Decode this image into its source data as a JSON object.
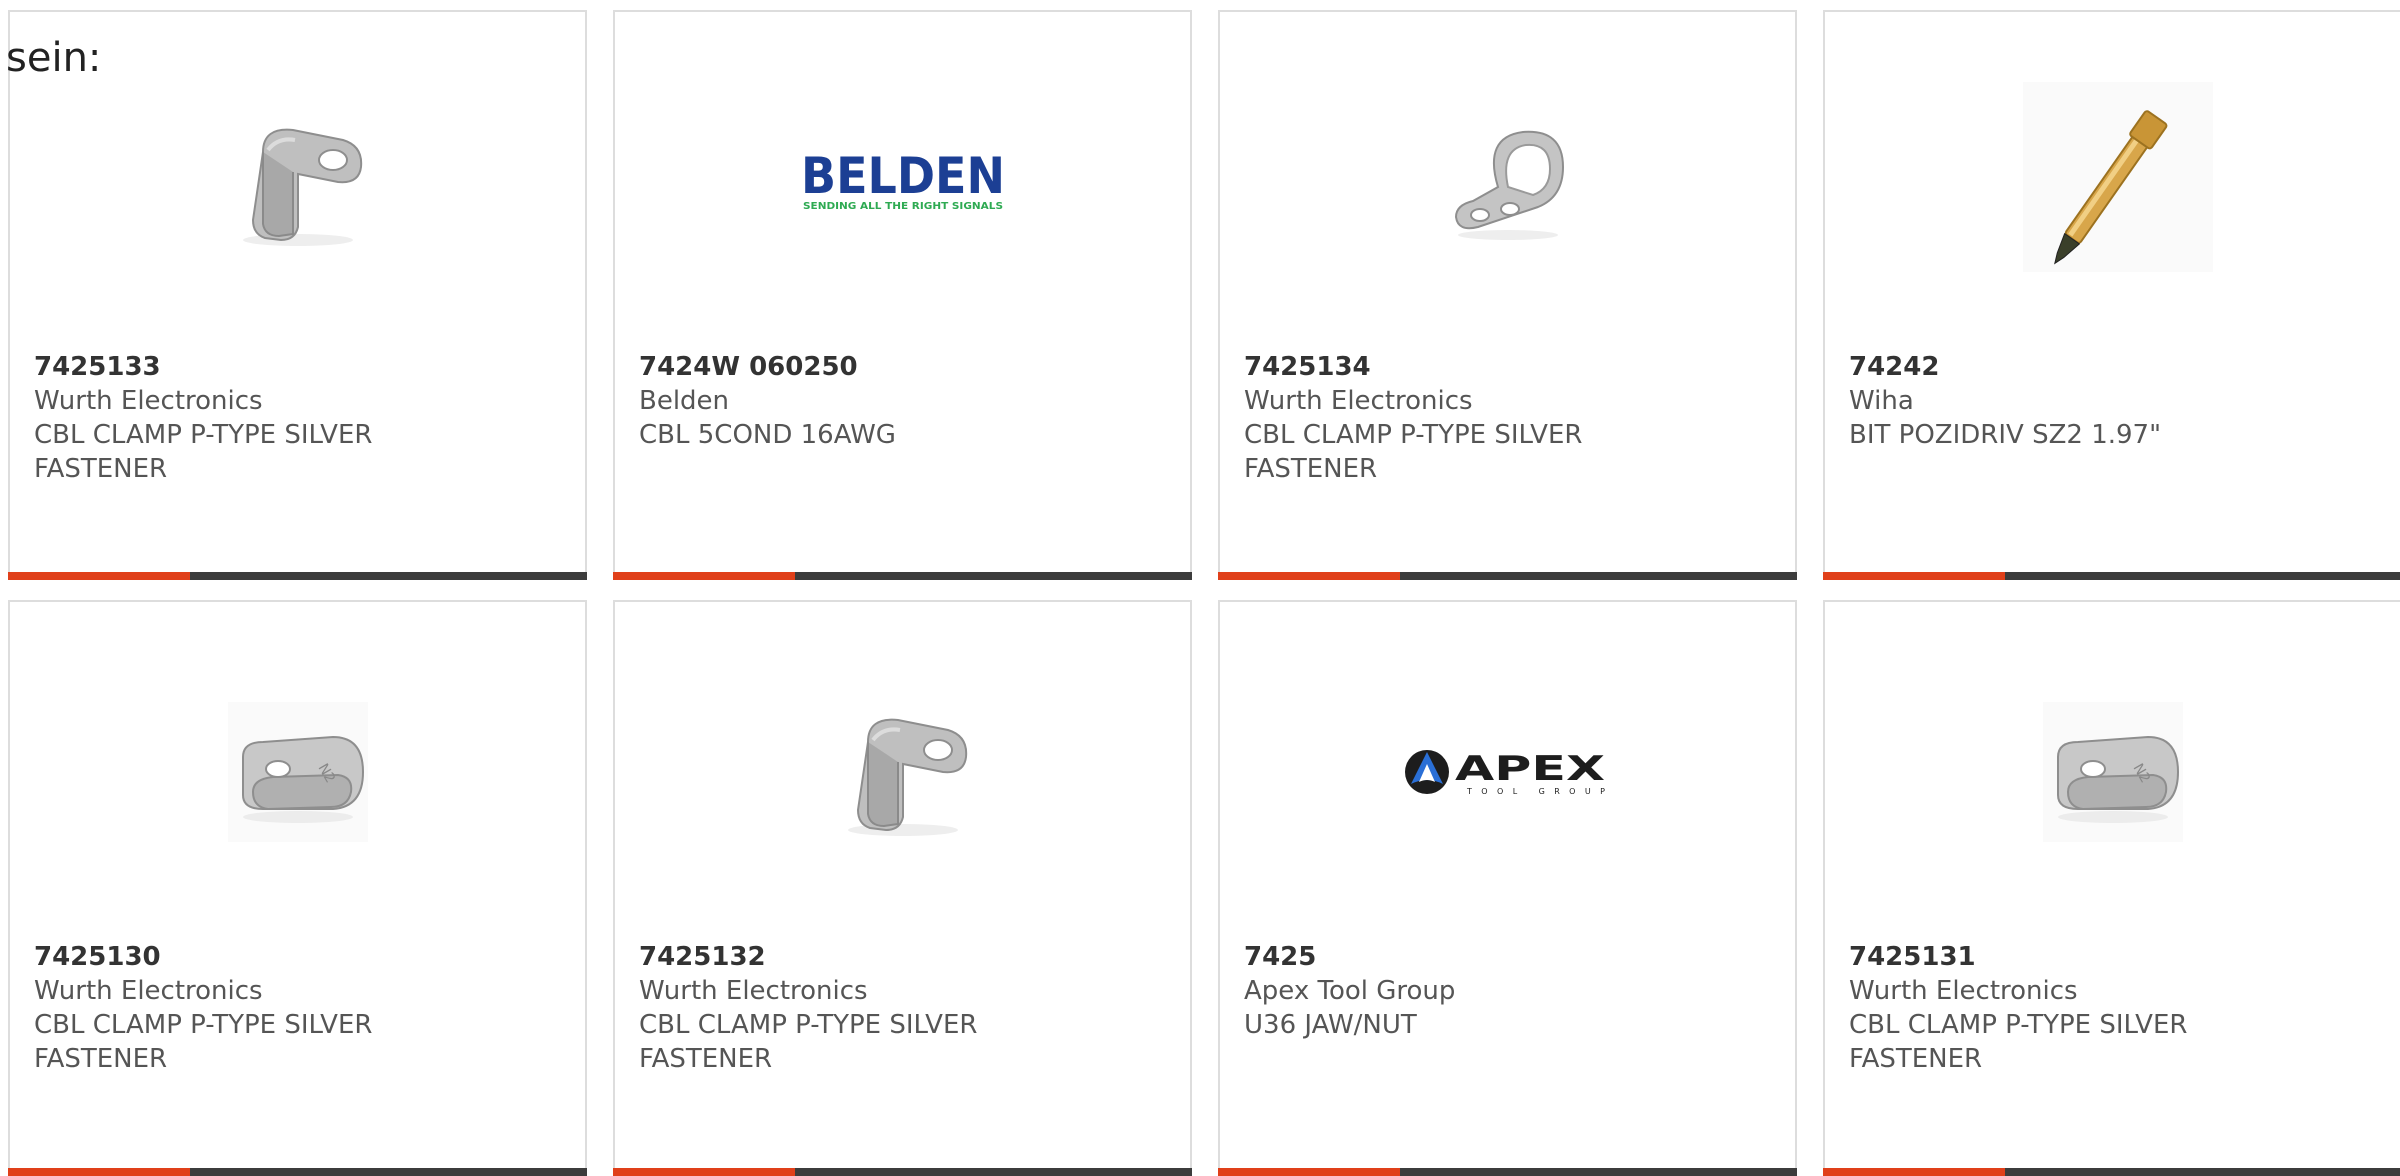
{
  "intro_text": "sein:",
  "colors": {
    "accent": "#e0401a",
    "bar": "#3c3c3c",
    "border": "#dddddd",
    "belden_blue": "#1c3f94",
    "belden_green": "#2eaa52"
  },
  "products": [
    {
      "part_number": "7425133",
      "manufacturer": "Wurth Electronics",
      "description": "CBL CLAMP P-TYPE SILVER FASTENER",
      "image": "cable-clamp-side-icon"
    },
    {
      "part_number": "7424W 060250",
      "manufacturer": "Belden",
      "description": "CBL 5COND 16AWG",
      "image": "belden-logo",
      "logo_text": "BELDEN",
      "logo_tagline": "SENDING ALL THE RIGHT SIGNALS"
    },
    {
      "part_number": "7425134",
      "manufacturer": "Wurth Electronics",
      "description": "CBL CLAMP P-TYPE SILVER FASTENER",
      "image": "cable-clamp-p-icon"
    },
    {
      "part_number": "74242",
      "manufacturer": "Wiha",
      "description": "BIT POZIDRIV SZ2 1.97\"",
      "image": "screwdriver-bit-icon"
    },
    {
      "part_number": "7425130",
      "manufacturer": "Wurth Electronics",
      "description": "CBL CLAMP P-TYPE SILVER FASTENER",
      "image": "cable-clamp-flat-icon"
    },
    {
      "part_number": "7425132",
      "manufacturer": "Wurth Electronics",
      "description": "CBL CLAMP P-TYPE SILVER FASTENER",
      "image": "cable-clamp-side-icon"
    },
    {
      "part_number": "7425",
      "manufacturer": "Apex Tool Group",
      "description": "U36 JAW/NUT",
      "image": "apex-logo",
      "logo_text": "APEX",
      "logo_tagline": "TOOL GROUP"
    },
    {
      "part_number": "7425131",
      "manufacturer": "Wurth Electronics",
      "description": "CBL CLAMP P-TYPE SILVER FASTENER",
      "image": "cable-clamp-flat-icon"
    }
  ]
}
